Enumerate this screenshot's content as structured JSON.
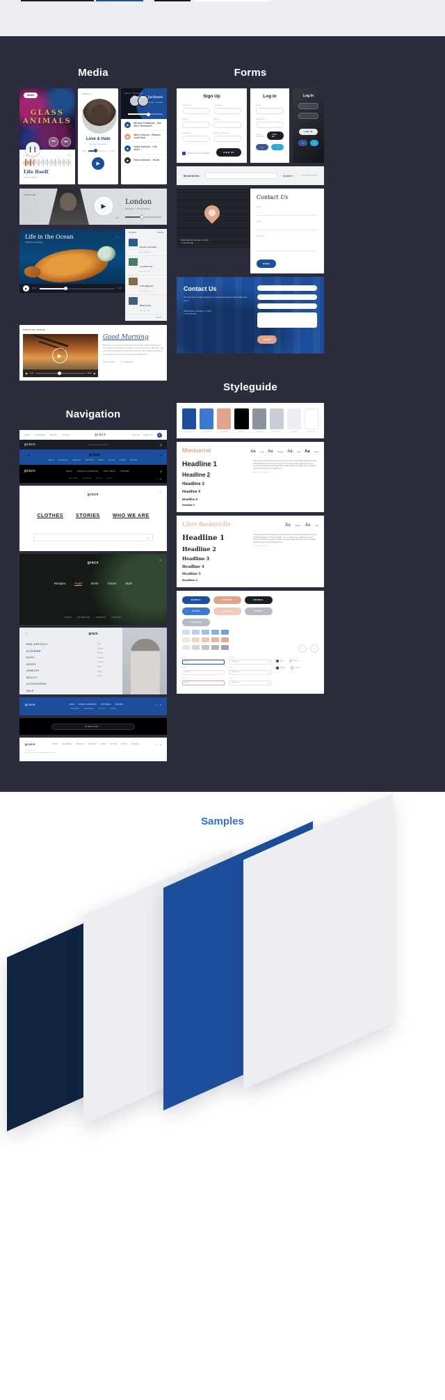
{
  "sections": {
    "media": "Media",
    "forms": "Forms",
    "navigation": "Navigation",
    "styleguide": "Styleguide",
    "samples": "Samples"
  },
  "colors": {
    "canvas_dark": "#2b2d3c",
    "accent_blue": "#1d4e9c",
    "accent_light_blue": "#3c7ad1",
    "accent_pink": "#e0a48c",
    "black": "#000000",
    "gray": "#b6bbc3",
    "light_gray": "#dfe2e7",
    "white": "#ffffff",
    "samples_title": "#2f6fd0"
  },
  "media": {
    "album": {
      "badge": "INDIE",
      "artist_line1": "GLASS",
      "artist_line2": "ANIMALS",
      "play_icon": "pause-icon",
      "prev_icon": "prev-icon",
      "next_icon": "next-icon"
    },
    "waveform": {
      "time_current": "1:14",
      "time_total": "4:17",
      "title": "Life Itself",
      "subtitle": "Glass Animals"
    },
    "profile": {
      "label": "SINGLE",
      "name": "Love & Hate",
      "artist": "Michael Kiwanuka",
      "time_current": "0:54",
      "time_total": "4:40",
      "play_icon": "play-icon"
    },
    "playlist": {
      "header_tag": "MOST POPULAR",
      "hero_title": "Rachel Jackson",
      "hero_sub": "Glass Animals · Life Itself",
      "items": [
        {
          "icon": "play-icon",
          "text": "Michael Kiwanuka - One More Heartache"
        },
        {
          "icon": "play-icon",
          "text": "Miley Cheeno - Flashes Junk Dark"
        },
        {
          "icon": "play-icon",
          "text": "Glass Animals - Life Itself"
        },
        {
          "icon": "play-icon",
          "text": "Glass Animals - Youth"
        }
      ]
    },
    "london": {
      "tag": "POPULAR",
      "title": "London",
      "subtitle": "Bangerton · Lifestyle Music",
      "time": "2:20",
      "play_icon": "play-icon"
    },
    "ocean": {
      "title": "Life in the Ocean",
      "subtitle": "National Geographic",
      "menu_icon": "more-icon",
      "time_current": "12:04",
      "time_total": "31:20",
      "sidebar_header_left": "UP NEXT",
      "sidebar_header_right": "CLEAR",
      "sidebar_items": [
        {
          "title": "Secrets of the Deep",
          "meta": "Nat Geo · 12:10"
        },
        {
          "title": "Coral Reef Life",
          "meta": "Nat Geo · 08:22"
        },
        {
          "title": "Arctic Migration",
          "meta": "Nat Geo · 21:44"
        },
        {
          "title": "Whale Songs",
          "meta": "Nat Geo · 16:05"
        }
      ],
      "see_all": "See all →"
    },
    "video": {
      "header_left": "POPULAR VIDEOS",
      "header_right": "• • • •",
      "title": "Good Morning",
      "body": "This film is an immersive look at daily sunrise and morning rituals across the continent, shot entirely on location at the break of dawn. Watching it, the soft purples and glowing oranges that bathe the alpine peaks and gullies in the cascading minutes during the first few twilight hours.",
      "tags": [
        "56:482 VIEWS",
        "12 COMMENTS"
      ],
      "time_current": "1:34",
      "time_total": "12:20",
      "play_icon": "play-icon"
    }
  },
  "forms": {
    "signup": {
      "title": "Sign Up",
      "fields": [
        {
          "label": "First Name",
          "value": ""
        },
        {
          "label": "Last Name",
          "value": ""
        },
        {
          "label": "Email",
          "value": ""
        },
        {
          "label": "Phone",
          "value": ""
        },
        {
          "label": "Password",
          "value": ""
        },
        {
          "label": "Confirm Password",
          "value": ""
        }
      ],
      "checkbox_label": "Subscribe to our Newsletter",
      "submit_label": "SIGN UP"
    },
    "login": {
      "title": "Log In",
      "fields": [
        {
          "label": "Email",
          "value": ""
        },
        {
          "label": "Password",
          "value": ""
        }
      ],
      "forgot_label": "Forgot Password?",
      "submit_label": "LOG IN",
      "social": [
        {
          "name": "facebook-button",
          "label": "f"
        },
        {
          "name": "twitter-button",
          "label": "t"
        }
      ]
    },
    "login_dark": {
      "title": "Log In",
      "fields": [
        {
          "label": "Email",
          "value": ""
        },
        {
          "label": "Password",
          "value": ""
        }
      ],
      "submit_label": "LOG IN",
      "social": [
        {
          "name": "facebook-button",
          "label": "f"
        },
        {
          "name": "twitter-button",
          "label": "t"
        }
      ]
    },
    "newsletter": {
      "title": "Newsletter",
      "input_placeholder": "Your e-mail address",
      "button_label": "SUBMIT  →",
      "note": "See office all times"
    },
    "contact": {
      "map_pin": "location-pin-icon",
      "address": "668 Bedford Ave, Brooklyn, NY 11211\n+1 347 825 1626",
      "panel_title_main": "Contact",
      "panel_title_italic": "Us",
      "fields": [
        {
          "label": "Name",
          "value": ""
        },
        {
          "label": "Email",
          "value": ""
        },
        {
          "label": "Message",
          "value": ""
        }
      ],
      "submit_label": "SEND"
    },
    "cta": {
      "title": "Contact Us",
      "body": "You can send us any questions or comments and we will contact you soon.",
      "address": "668 Bedford Ave, Brooklyn, NY 11211\n+1 347 825 1626",
      "fields": [
        {
          "label": "Name",
          "value": ""
        },
        {
          "label": "Email",
          "value": ""
        },
        {
          "label": "Subject",
          "value": ""
        },
        {
          "label": "Message",
          "value": ""
        }
      ],
      "submit_label": "SEND"
    }
  },
  "navigation": {
    "brand": "grace",
    "bar_white": {
      "links": [
        "TECH",
        "SCIENCE",
        "MUSIC",
        "STYLE"
      ],
      "right_links": [
        "LOG IN",
        "SIGN UP"
      ],
      "avatar_icon": "user-avatar-icon"
    },
    "bar_dark": {
      "tagline": "Trip Ideas for Everyone",
      "search_icon": "search-icon"
    },
    "bar_blue": {
      "social": [
        "facebook-icon",
        "twitter-icon"
      ],
      "search_icon": "search-icon",
      "links": [
        "TECH",
        "SCIENCE",
        "HEALTH",
        "SPORTS",
        "ARTS",
        "STYLE",
        "FOOD",
        "TRAVEL"
      ]
    },
    "bar_black": {
      "links": [
        "NEWS",
        "HOTELS & RESORTS",
        "TRIP IDEAS",
        "CRUISES"
      ],
      "sublinks": [
        "AIR TRAVEL",
        "CAR RENTAL",
        "PHOTOS",
        "VIDEOS"
      ],
      "search_icon": "search-icon",
      "social": [
        "facebook-icon",
        "twitter-icon"
      ]
    },
    "menu_white": {
      "close_icon": "close-icon",
      "items": [
        "CLOTHES",
        "STORIES",
        "WHO WE ARE"
      ],
      "search_placeholder": "",
      "search_icon": "search-icon"
    },
    "menu_dark": {
      "close_icon": "close-icon",
      "items": [
        "Recipes",
        "Food",
        "Drink",
        "Travel",
        "Style"
      ],
      "active_item": "Food",
      "footer_links": [
        "ABOUT",
        "ADVERTISE",
        "CAREERS",
        "CONTACT"
      ]
    },
    "menu_split": {
      "close_icon": "close-icon",
      "expand_icon": "expand-icon",
      "items": [
        "NEW ARRIVALS",
        "CLOTHING",
        "BAGS",
        "SHOES",
        "JEWELRY",
        "BEAUTY",
        "ACCESSORIES",
        "SALE"
      ],
      "active_item": "CLOTHING",
      "sub_items": [
        "Tops",
        "Dresses",
        "Jackets",
        "Knitwear",
        "Trousers",
        "Skirts",
        "Denim",
        "Shorts"
      ]
    },
    "footer_blue": {
      "links": [
        "NEWS",
        "HOTELS & RESORTS",
        "TRIP IDEAS",
        "CRUISES"
      ],
      "sublinks": [
        "AIR TRAVEL",
        "CAR RENTAL",
        "PHOTOS",
        "VIDEOS"
      ],
      "social": [
        "facebook-icon",
        "twitter-icon"
      ]
    },
    "footer_black": {
      "subscribe_label": "SUBSCRIBE  →"
    },
    "footer_white": {
      "links": [
        "TECH",
        "SCIENCE",
        "HEALTH",
        "SPORTS",
        "ARTS",
        "STYLE",
        "FOOD",
        "TRAVEL"
      ],
      "copyright": "© 2017 grace",
      "social": [
        "facebook-icon",
        "twitter-icon"
      ],
      "note": "All rights reserved. Designed by grace studio."
    }
  },
  "styleguide": {
    "swatches": [
      {
        "hex": "#1d4e9c",
        "name": "#1D4E9C"
      },
      {
        "hex": "#3c7ad1",
        "name": "#3C7AD1"
      },
      {
        "hex": "#e0a48c",
        "name": "#E0A48C"
      },
      {
        "hex": "#000000",
        "name": "#000000"
      },
      {
        "hex": "#8d939e",
        "name": "#8D939E"
      },
      {
        "hex": "#c9ced6",
        "name": "#C9CED6"
      },
      {
        "hex": "#eceef1",
        "name": "#ECEEF1"
      },
      {
        "hex": "#ffffff",
        "name": "#FFFFFF"
      }
    ],
    "fonts": [
      {
        "name": "Montserrat",
        "weights": [
          {
            "sample": "Aa",
            "label": "Light"
          },
          {
            "sample": "Aa",
            "label": "Regular"
          },
          {
            "sample": "Aa",
            "label": "Bold"
          },
          {
            "sample": "Aa",
            "label": "Black"
          }
        ],
        "headlines": [
          "Headline 1",
          "Headline 2",
          "Headline 3",
          "Headline 4",
          "Headline 5",
          "Headline 6"
        ],
        "body": "The legendary Scottish-American canyon entered John Muir dubbed California's Sierra Nevada Mountains the \"Range of Light\". It is an elegant name, alluding to the soft purples and glowing oranges that bathe the alpine peaks and gullies in the cascading weeks during the first few twilight hours.",
        "caption": "Light Text reading 9 px"
      },
      {
        "name": "Libre Baskerville",
        "weights": [
          {
            "sample": "Aa",
            "label": "Regular"
          },
          {
            "sample": "Aa",
            "label": "Italic"
          }
        ],
        "headlines": [
          "Headline 1",
          "Headline 2",
          "Headline 3",
          "Headline 4",
          "Headline 5",
          "Headline 6"
        ],
        "body": "The legendary Scottish-American conservationist John Muir dubbed California's Sierra Nevada Mountains the \"Range of Light\". It is an elegant name, alluding to the soft purples and glowing oranges that bathe the alpine peaks and gullies in the cascading weeks during the first few twilight hours.",
        "caption": "Body Text reading 9 px"
      }
    ],
    "buttons": [
      {
        "label": "NORMAL",
        "style": "b-blue"
      },
      {
        "label": "NORMAL",
        "style": "b-pink"
      },
      {
        "label": "NORMAL",
        "style": "b-dark"
      },
      {
        "label": "HOVER",
        "style": "b-lblue"
      },
      {
        "label": "HOVER",
        "style": "b-lpink"
      },
      {
        "label": "HOVER",
        "style": "b-gray"
      },
      {
        "label": "DISABLED",
        "style": "b-gray"
      }
    ],
    "palette_rows": [
      [
        "#cfe0f5",
        "#b7d0ef",
        "#9ec0e9",
        "#85b0e3",
        "#6ca0dd"
      ],
      [
        "#f7e4db",
        "#f2d5c8",
        "#edc6b5",
        "#e8b7a2",
        "#e3a88f"
      ],
      [
        "#e4e6ea",
        "#d2d5db",
        "#c0c4cc",
        "#aeb3bd",
        "#9ca2ae"
      ]
    ],
    "arrows": [
      "←",
      "→"
    ],
    "form_fields": [
      {
        "label": "Name",
        "value": "Active",
        "state": "b"
      },
      {
        "label": "Email",
        "value": "Normal",
        "state": ""
      },
      {
        "label": "Phone",
        "value": "Error",
        "state": "p"
      }
    ],
    "selects": [
      {
        "label": "Country",
        "value": "Select one"
      },
      {
        "label": "State",
        "value": "Select one"
      },
      {
        "label": "City",
        "value": "Select one"
      }
    ],
    "toggles": [
      {
        "label": "Active",
        "type": "radio",
        "on": true
      },
      {
        "label": "Normal",
        "type": "radio",
        "on": false
      },
      {
        "label": "Enabled",
        "type": "checkbox",
        "on": true
      },
      {
        "label": "Disabled",
        "type": "checkbox",
        "on": false
      }
    ]
  }
}
